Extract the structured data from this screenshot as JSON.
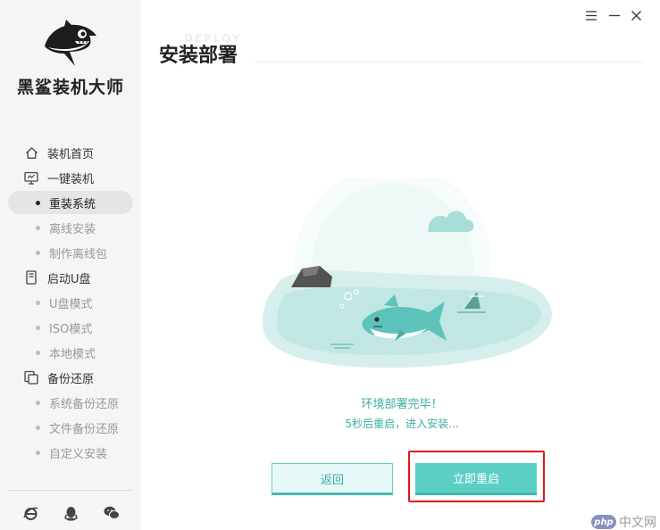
{
  "app": {
    "brand": "黑鲨装机大师"
  },
  "nav": {
    "home": "装机首页",
    "one_click": "一键装机",
    "reinstall": "重装系统",
    "offline_install": "离线安装",
    "make_offline": "制作离线包",
    "boot_usb": "启动U盘",
    "usb_mode": "U盘模式",
    "iso_mode": "ISO模式",
    "local_mode": "本地模式",
    "backup_restore": "备份还原",
    "sys_backup": "系统备份还原",
    "file_backup": "文件备份还原",
    "custom_install": "自定义安装"
  },
  "main": {
    "title": "安装部署",
    "title_watermark": "DEPLOY",
    "status_line1": "环境部署完毕！",
    "status_line2": "5秒后重启，进入安装...",
    "back_button": "返回",
    "reboot_button": "立即重启"
  },
  "watermark": {
    "badge": "php",
    "text": "中文网"
  },
  "colors": {
    "accent": "#5ccfc5",
    "accent_text": "#3aaea3",
    "highlight": "#e01818",
    "sidebar_bg": "#f5f5f5"
  },
  "icons": {
    "home": "home-icon",
    "one_click": "monitor-icon",
    "boot_usb": "usb-drive-icon",
    "backup_restore": "backup-icon",
    "footer": [
      "ie-browser-icon",
      "qq-icon",
      "wechat-icon"
    ],
    "window": [
      "menu-icon",
      "minimize-icon",
      "close-icon"
    ]
  }
}
